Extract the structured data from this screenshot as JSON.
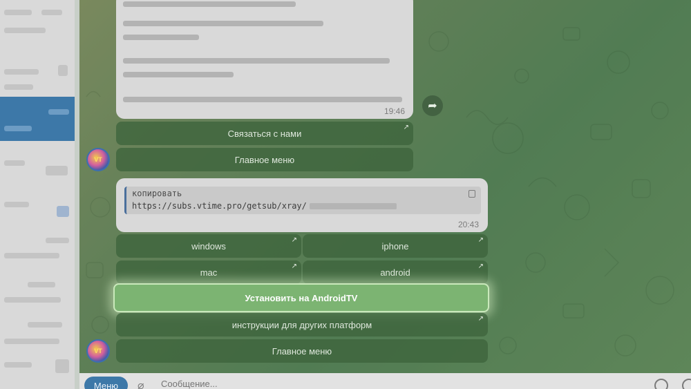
{
  "messages": [
    {
      "time": "19:46"
    },
    {
      "copy_label": "копировать",
      "url": "https://subs.vtime.pro/getsub/xray/",
      "time": "20:43"
    }
  ],
  "keyboard1": {
    "contact": "Связаться с нами",
    "main_menu": "Главное меню"
  },
  "keyboard2": {
    "windows": "windows",
    "iphone": "iphone",
    "mac": "mac",
    "android": "android",
    "install_androidtv": "Установить на AndroidTV",
    "other_platforms": "инструкции для других платформ",
    "main_menu": "Главное меню"
  },
  "composer": {
    "menu_label": "Меню",
    "placeholder": "Сообщение..."
  },
  "icons": {
    "share": "share-icon",
    "copy": "copy-icon",
    "attach": "paperclip-icon",
    "emoji": "emoji-icon",
    "mic": "microphone-icon",
    "button_link": "arrow-up-right-icon"
  },
  "colors": {
    "accent": "#3d78a8",
    "highlight": "#7cb472"
  }
}
